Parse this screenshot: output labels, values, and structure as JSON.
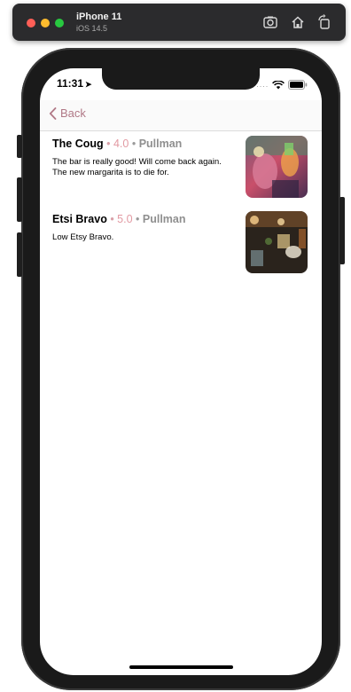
{
  "simulator": {
    "device_name": "iPhone 11",
    "os_version": "iOS 14.5"
  },
  "status_bar": {
    "time": "11:31",
    "location_arrow": "➤",
    "signal": "····"
  },
  "nav": {
    "back_label": "Back"
  },
  "reviews": [
    {
      "name": "The Coug",
      "separator": " • ",
      "rating": "4.0",
      "city": "Pullman",
      "text": "The bar is really good! Will come back again.\nThe new margarita is to die for."
    },
    {
      "name": "Etsi Bravo",
      "separator": " • ",
      "rating": "5.0",
      "city": "Pullman",
      "text": "Low Etsy Bravo."
    }
  ],
  "colors": {
    "accent": "#b07886",
    "rating": "#e29aa3"
  }
}
